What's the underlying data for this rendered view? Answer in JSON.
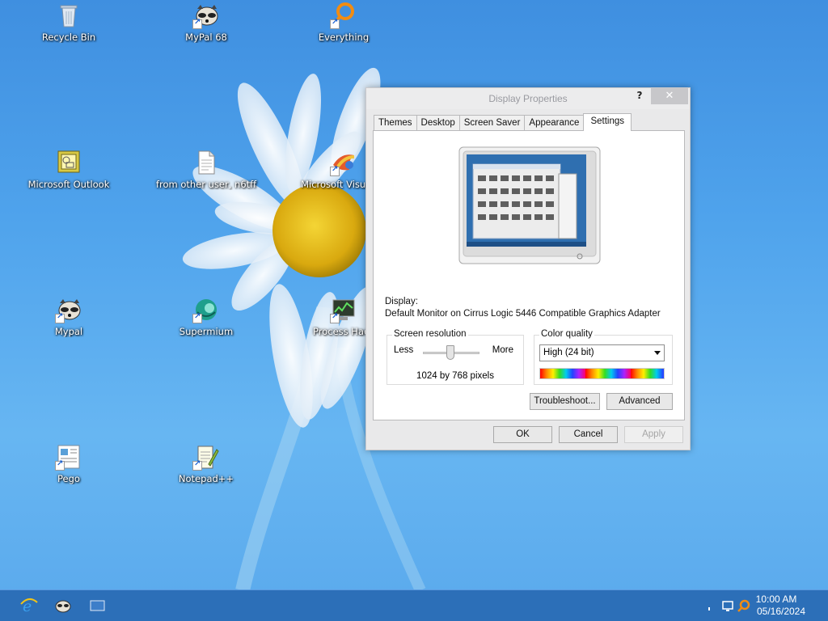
{
  "desktop": {
    "icons": [
      {
        "label": "Recycle Bin",
        "icon": "recycle-bin-icon"
      },
      {
        "label": "MyPal 68",
        "icon": "raccoon-icon"
      },
      {
        "label": "Everything",
        "icon": "everything-search-icon"
      },
      {
        "label": "Microsoft Outlook",
        "icon": "outlook-icon"
      },
      {
        "label": "from other user, n6tff",
        "icon": "document-icon"
      },
      {
        "label": "Microsoft Visual St",
        "icon": "visual-studio-icon"
      },
      {
        "label": "Mypal",
        "icon": "raccoon-icon"
      },
      {
        "label": "Supermium",
        "icon": "supermium-icon"
      },
      {
        "label": "Process Hack",
        "icon": "process-hacker-icon"
      },
      {
        "label": "Pego",
        "icon": "pego-icon"
      },
      {
        "label": "Notepad++",
        "icon": "notepad-plus-icon"
      }
    ]
  },
  "dialog": {
    "title": "Display Properties",
    "help_label": "?",
    "close_label": "✕",
    "tabs": [
      {
        "label": "Themes"
      },
      {
        "label": "Desktop"
      },
      {
        "label": "Screen Saver"
      },
      {
        "label": "Appearance"
      },
      {
        "label": "Settings"
      }
    ],
    "active_tab": "Settings",
    "display_label": "Display:",
    "display_value": "Default Monitor on Cirrus Logic 5446 Compatible Graphics Adapter",
    "resolution": {
      "title": "Screen resolution",
      "less": "Less",
      "more": "More",
      "value": "1024 by 768 pixels"
    },
    "color_quality": {
      "title": "Color quality",
      "selected": "High (24 bit)"
    },
    "buttons": {
      "troubleshoot": "Troubleshoot...",
      "advanced": "Advanced",
      "ok": "OK",
      "cancel": "Cancel",
      "apply": "Apply"
    }
  },
  "taskbar": {
    "items": [
      "ie-icon",
      "raccoon-icon",
      "desktop-icon"
    ],
    "tray": [
      "network-icon",
      "search-icon"
    ],
    "time": "10:00 AM",
    "date": "05/16/2024"
  },
  "colors": {
    "desktop_blue": "#4fa3ec",
    "taskbar": "#2c6fb8",
    "dialog_bg": "#e9e9ea",
    "close_button": "#c7c7ca"
  }
}
